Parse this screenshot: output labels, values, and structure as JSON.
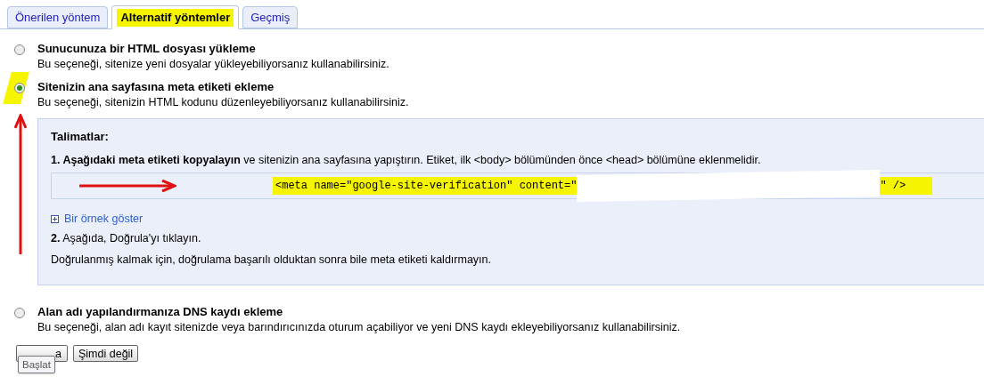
{
  "tabs": [
    {
      "label": "Önerilen yöntem",
      "selected": false
    },
    {
      "label": "Alternatif yöntemler",
      "selected": true
    },
    {
      "label": "Geçmiş",
      "selected": false
    }
  ],
  "options": [
    {
      "title": "Sunucunuza bir HTML dosyası yükleme",
      "description": "Bu seçeneği, sitenize yeni dosyalar yükleyebiliyorsanız kullanabilirsiniz.",
      "selected": false
    },
    {
      "title": "Sitenizin ana sayfasına meta etiketi ekleme",
      "description": "Bu seçeneği, sitenizin HTML kodunu düzenleyebiliyorsanız kullanabilirsiniz.",
      "selected": true,
      "instructions": {
        "heading": "Talimatlar:",
        "step1": "**1. Aşağıdaki meta etiketi kopyalayın** ve sitenizin ana sayfasına yapıştırın. Etiket, ilk <body> bölümünden önce <head> bölümüne eklenmelidir.",
        "code_start": "<meta name=\"google-site-verification\" content=\"",
        "code_end": "\" />",
        "example_link": "Bir örnek göster",
        "step2": "**2.** Aşağıda, Doğrula'yı tıklayın.",
        "note": "Doğrulanmış kalmak için, doğrulama başarılı olduktan sonra bile meta etiketi kaldırmayın."
      }
    },
    {
      "title": "Alan adı yapılandırmanıza DNS kaydı ekleme",
      "description": "Bu seçeneği, alan adı kayıt sitenizde veya barındırıcınızda oturum açabiliyor ve yeni DNS kaydı ekleyebiliyorsanız kullanabilirsiniz.",
      "selected": false
    }
  ],
  "buttons": [
    {
      "label": "a"
    },
    {
      "label": "Şimdi değil"
    }
  ],
  "tooltip": "Başlat"
}
